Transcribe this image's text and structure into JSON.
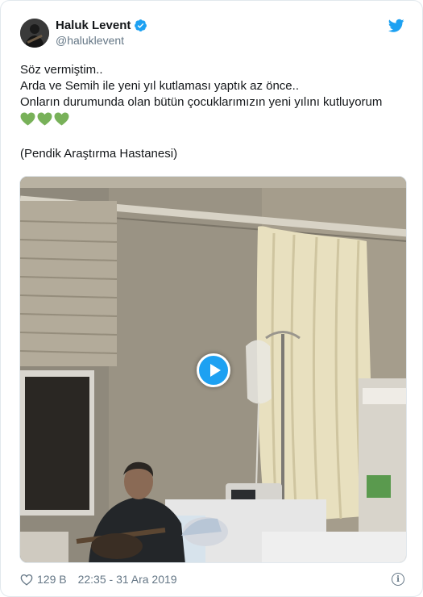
{
  "author": {
    "display_name": "Haluk Levent",
    "handle": "@haluklevent",
    "verified_icon": "verified-badge-icon",
    "avatar_icon": "avatar"
  },
  "brand": {
    "logo_icon": "twitter-bird-icon",
    "accent_color": "#1da1f2"
  },
  "tweet": {
    "lines": [
      "Söz vermiştim..",
      "Arda ve Semih ile yeni yıl kutlaması yaptık az önce..",
      "Onların durumunda olan bütün çocuklarımızın yeni yılını kutluyorum"
    ],
    "emojis": [
      "green-heart-icon",
      "green-heart-icon",
      "green-heart-icon"
    ],
    "emoji_color": "#78b159",
    "location_line": "(Pendik Araştırma Hastanesi)"
  },
  "media": {
    "type": "video",
    "play_icon": "play-icon",
    "play_button_color": "#1da1f2"
  },
  "footer": {
    "like_icon": "heart-outline-icon",
    "like_count": "129 B",
    "timestamp": "22:35 - 31 Ara 2019",
    "info_icon": "info-icon"
  }
}
